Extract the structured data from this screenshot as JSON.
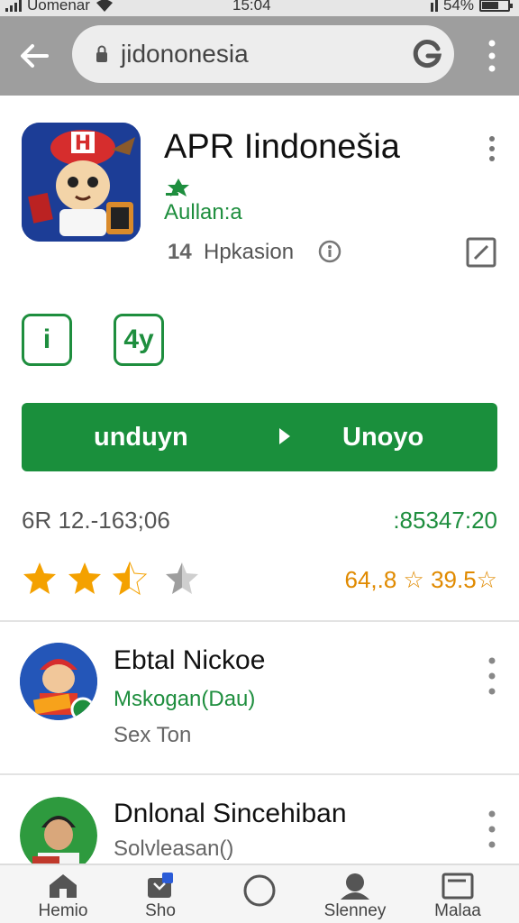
{
  "status_bar": {
    "carrier": "Uomenar",
    "time": "15:04",
    "battery": "54%"
  },
  "browser": {
    "url": "jidononesia"
  },
  "app": {
    "title": "APR Iindonešia",
    "developer": "Aullan:a",
    "category_code": "14",
    "category": "Hpkasion",
    "badges": [
      "i",
      "4y"
    ],
    "install_left": "unduyn",
    "install_right": "Unoyo",
    "stat_left": "6R 12.-163;06",
    "stat_right": ":85347:20",
    "rating_value": 3.5,
    "rating_text": "64,.8 ☆ 39.5☆"
  },
  "reviews": [
    {
      "name": "Ebtal Nickoe",
      "subtitle": "Mskogan(Dau)",
      "detail": "Sex Ton"
    },
    {
      "name": "Dnlonal Sincehiban",
      "subtitle": "Solvleasan()",
      "detail": ""
    }
  ],
  "bottom_nav": [
    {
      "label": "Hemio",
      "icon": "home-icon"
    },
    {
      "label": "Sho",
      "icon": "store-icon"
    },
    {
      "label": "",
      "icon": "circle-icon"
    },
    {
      "label": "Slenney",
      "icon": "person-icon"
    },
    {
      "label": "Malaa",
      "icon": "inbox-icon"
    }
  ],
  "colors": {
    "accent_green": "#1a8f3c",
    "star_orange": "#f4a100",
    "toolbar_gray": "#9e9e9e"
  }
}
